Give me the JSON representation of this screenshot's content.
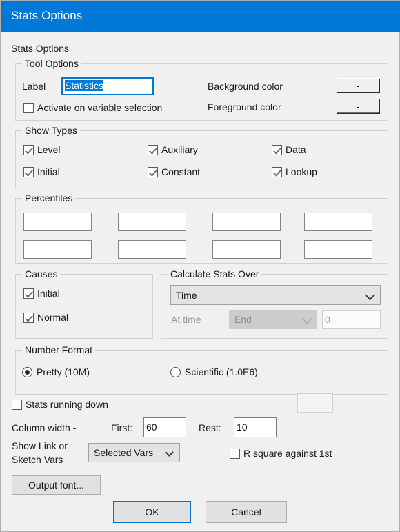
{
  "window": {
    "title": "Stats Options"
  },
  "heading": "Stats Options",
  "tool_options": {
    "group_title": "Tool Options",
    "label_caption": "Label",
    "label_value": "Statistics",
    "activate_checkbox": "Activate on variable selection",
    "background_color_caption": "Background color",
    "foreground_color_caption": "Foreground color",
    "background_color_button": "-",
    "foreground_color_button": "-"
  },
  "show_types": {
    "group_title": "Show Types",
    "items": [
      {
        "label": "Level",
        "checked": true
      },
      {
        "label": "Auxiliary",
        "checked": true
      },
      {
        "label": "Data",
        "checked": true
      },
      {
        "label": "Initial",
        "checked": true
      },
      {
        "label": "Constant",
        "checked": true
      },
      {
        "label": "Lookup",
        "checked": true
      }
    ]
  },
  "percentiles": {
    "group_title": "Percentiles",
    "values": [
      "",
      "",
      "",
      "",
      "",
      "",
      "",
      ""
    ]
  },
  "causes": {
    "group_title": "Causes",
    "items": [
      {
        "label": "Initial",
        "checked": true
      },
      {
        "label": "Normal",
        "checked": true
      }
    ]
  },
  "calculate_stats_over": {
    "group_title": "Calculate Stats Over",
    "over_value": "Time",
    "at_time_caption": "At time",
    "at_time_value": "End",
    "at_time_number": "0"
  },
  "number_format": {
    "group_title": "Number Format",
    "pretty_label": "Pretty (10M)",
    "pretty_selected": true,
    "scientific_label": "Scientific (1.0E6)",
    "scientific_selected": false,
    "scientific_value": ""
  },
  "bottom": {
    "stats_running_down": "Stats running down",
    "stats_running_down_checked": false,
    "column_width_caption": "Column width -",
    "first_caption": "First:",
    "first_value": "60",
    "rest_caption": "Rest:",
    "rest_value": "10",
    "show_link_caption_line1": "Show Link or",
    "show_link_caption_line2": "Sketch Vars",
    "show_link_value": "Selected Vars",
    "r_square_label": "R square against 1st",
    "r_square_checked": false
  },
  "buttons": {
    "output_font": "Output font...",
    "ok": "OK",
    "cancel": "Cancel"
  },
  "colors": {
    "accent": "#0078d7",
    "dialog_bg": "#f0f0f0",
    "control_bg": "#e1e1e1"
  }
}
